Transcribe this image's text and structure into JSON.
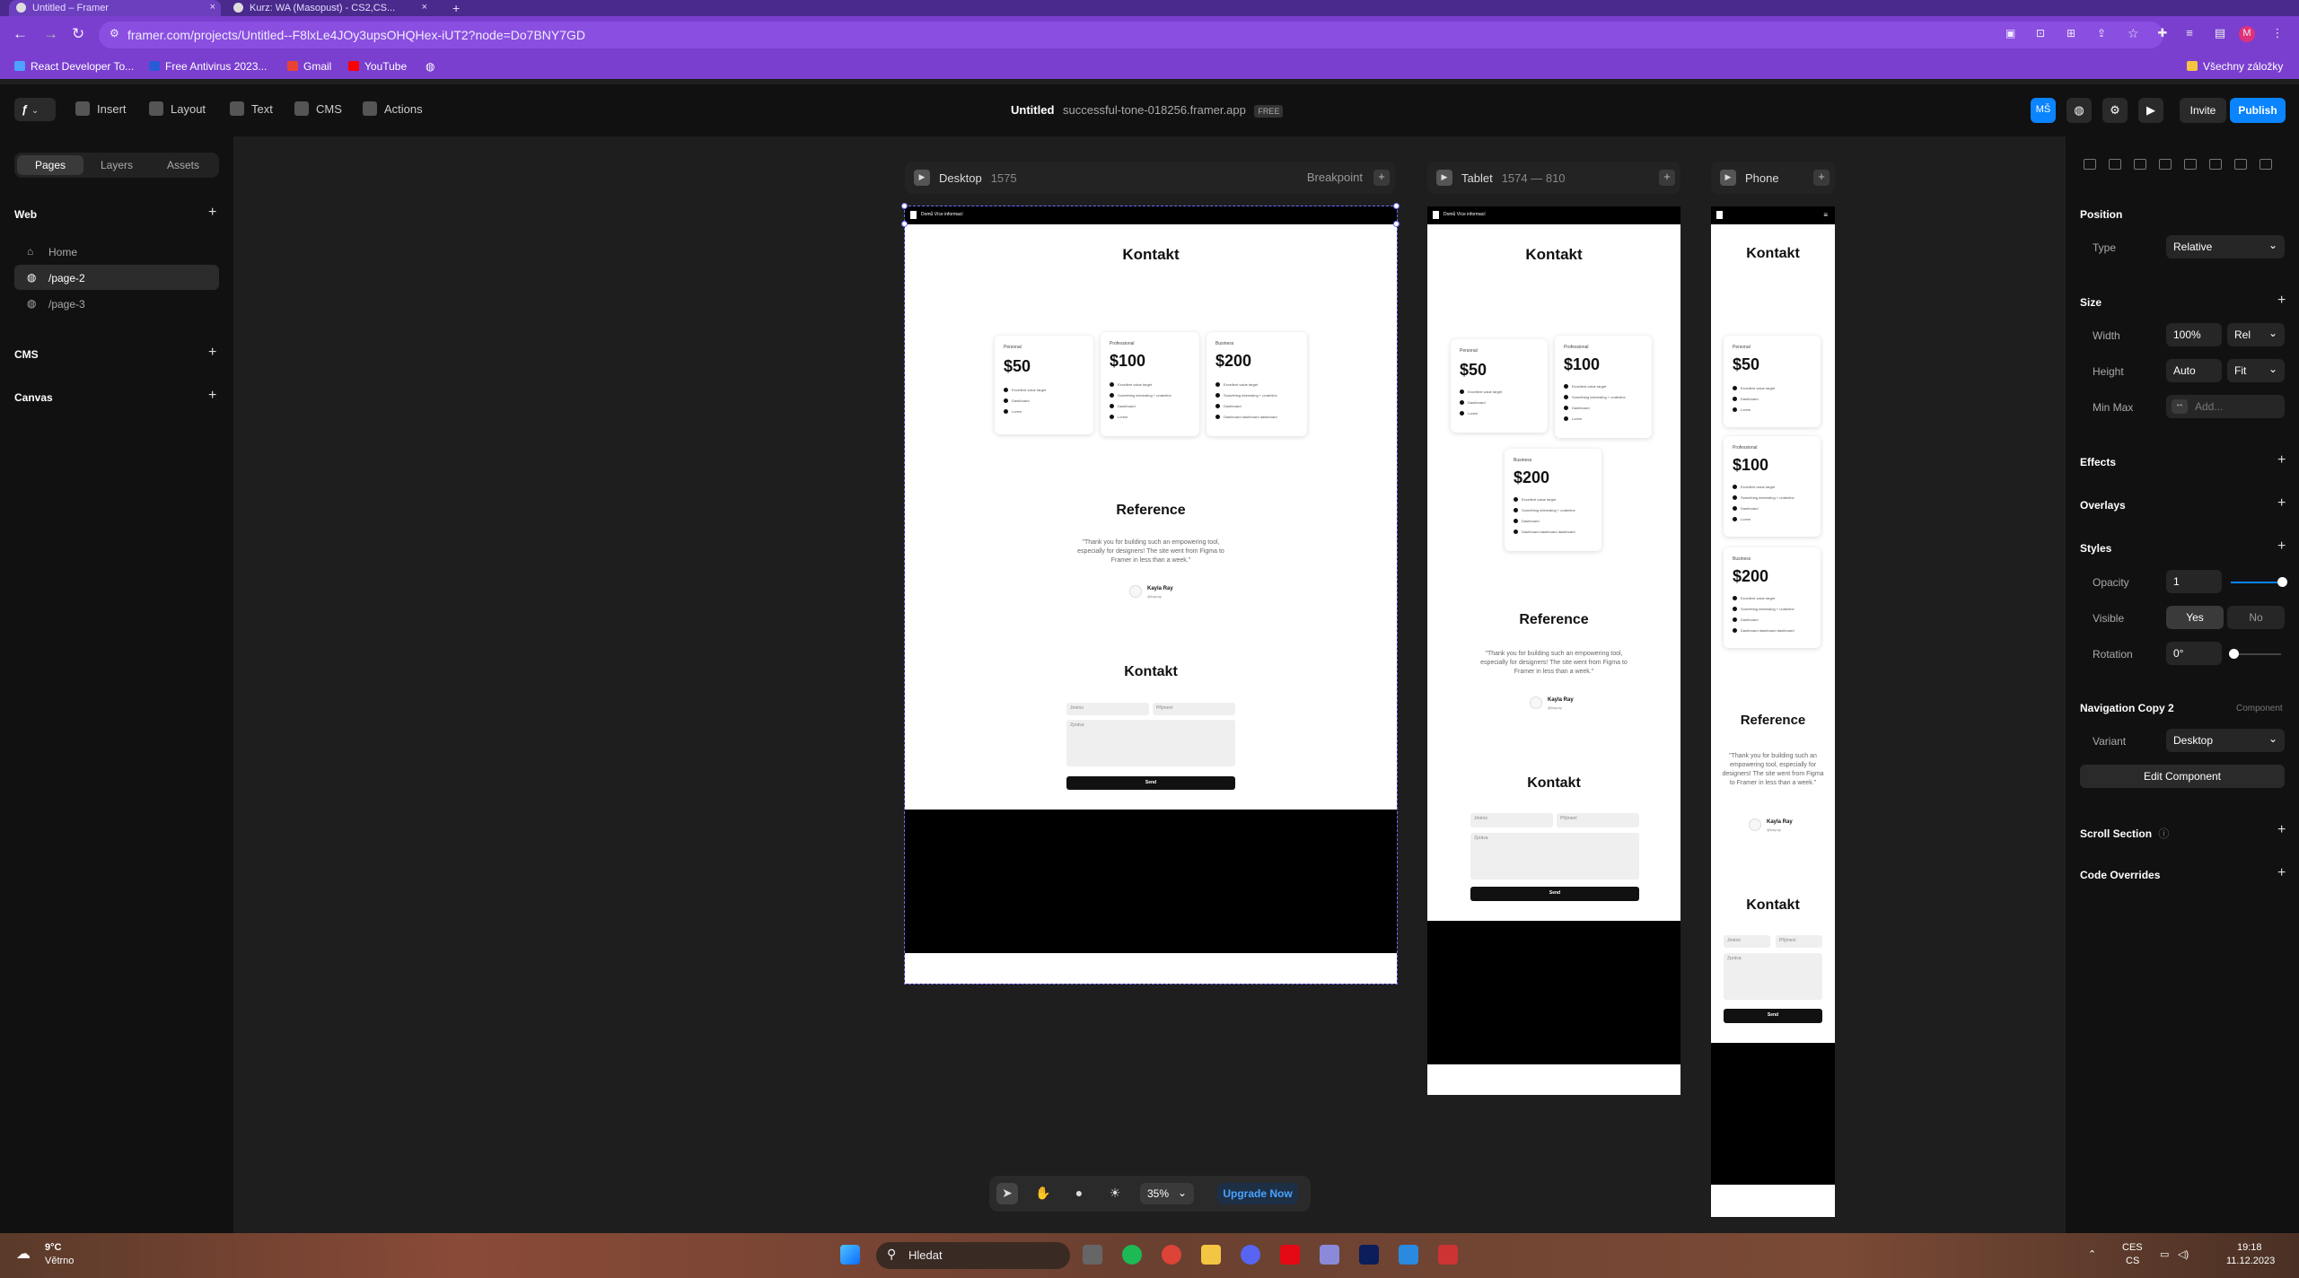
{
  "browser": {
    "tabs": [
      {
        "title": "Untitled – Framer",
        "active": true
      },
      {
        "title": "Kurz: WA (Masopust) - CS2,CS...",
        "active": false
      }
    ],
    "url": "framer.com/projects/Untitled--F8lxLe4JOy3upsOHQHex-iUT2?node=Do7BNY7GD",
    "bookmarks": [
      {
        "label": "React Developer To...",
        "color": "#4ea1ff"
      },
      {
        "label": "Free Antivirus 2023...",
        "color": "#2a5bd7"
      },
      {
        "label": "Gmail",
        "color": "#ea4335"
      },
      {
        "label": "YouTube",
        "color": "#ff0000"
      }
    ],
    "bookmarks_folder": "Všechny záložky",
    "profile_initial": "M"
  },
  "toolbar": {
    "menu": [
      "Insert",
      "Layout",
      "Text",
      "CMS",
      "Actions"
    ],
    "doc_title": "Untitled",
    "site": "successful-tone-018256.framer.app",
    "plan": "FREE",
    "user_initials": "MŠ",
    "invite": "Invite",
    "publish": "Publish"
  },
  "left": {
    "tabs": [
      "Pages",
      "Layers",
      "Assets"
    ],
    "active_tab": "Pages",
    "web_label": "Web",
    "pages": [
      "Home",
      "/page-2",
      "/page-3"
    ],
    "active_page": "/page-2",
    "cms_label": "CMS",
    "canvas_label": "Canvas"
  },
  "breakpoints": {
    "desktop": {
      "name": "Desktop",
      "width": "1575",
      "action": "Breakpoint"
    },
    "tablet": {
      "name": "Tablet",
      "size": "1574 — 810"
    },
    "phone": {
      "name": "Phone"
    }
  },
  "site": {
    "nav_text": "Domů     Více informací",
    "heading_contact": "Kontakt",
    "heading_reference": "Reference",
    "plans": [
      {
        "label": "Personal",
        "price": "$50",
        "features": [
          "Excellent value target",
          "Dashboard",
          "Lorem"
        ]
      },
      {
        "label": "Professional",
        "price": "$100",
        "features": [
          "Excellent value target",
          "Something interesting + underline",
          "Dashboard",
          "Lorem"
        ]
      },
      {
        "label": "Business",
        "price": "$200",
        "features": [
          "Excellent value target",
          "Something interesting + underline",
          "Dashboard",
          "Dashboard dashboard dashboard"
        ]
      }
    ],
    "quote": "\"Thank you for building such an empowering tool, especially for designers! The site went from Figma to Framer in less than a week.\"",
    "author": "Kayla Ray",
    "author_handle": "@kayray",
    "form": {
      "first": "Jméno",
      "last": "Příjmení",
      "message": "Zpráva",
      "send": "Send"
    }
  },
  "right": {
    "position": "Position",
    "type_label": "Type",
    "type_value": "Relative",
    "size": "Size",
    "width_label": "Width",
    "width_value": "100%",
    "width_unit": "Rel",
    "height_label": "Height",
    "height_value": "Auto",
    "height_unit": "Fit",
    "minmax_label": "Min Max",
    "minmax_placeholder": "Add...",
    "effects": "Effects",
    "overlays": "Overlays",
    "styles": "Styles",
    "opacity_label": "Opacity",
    "opacity_value": "1",
    "visible_label": "Visible",
    "visible_yes": "Yes",
    "visible_no": "No",
    "rotation_label": "Rotation",
    "rotation_value": "0°",
    "component_name": "Navigation Copy 2",
    "component_tag": "Component",
    "variant_label": "Variant",
    "variant_value": "Desktop",
    "edit_component": "Edit Component",
    "scroll_section": "Scroll Section",
    "code_overrides": "Code Overrides"
  },
  "bottom": {
    "zoom": "35%",
    "upgrade": "Upgrade Now"
  },
  "taskbar": {
    "weather_temp": "9°C",
    "weather_desc": "Větrno",
    "search": "Hledat",
    "lang1": "CES",
    "lang2": "CS",
    "time": "19:18",
    "date": "11.12.2023"
  }
}
